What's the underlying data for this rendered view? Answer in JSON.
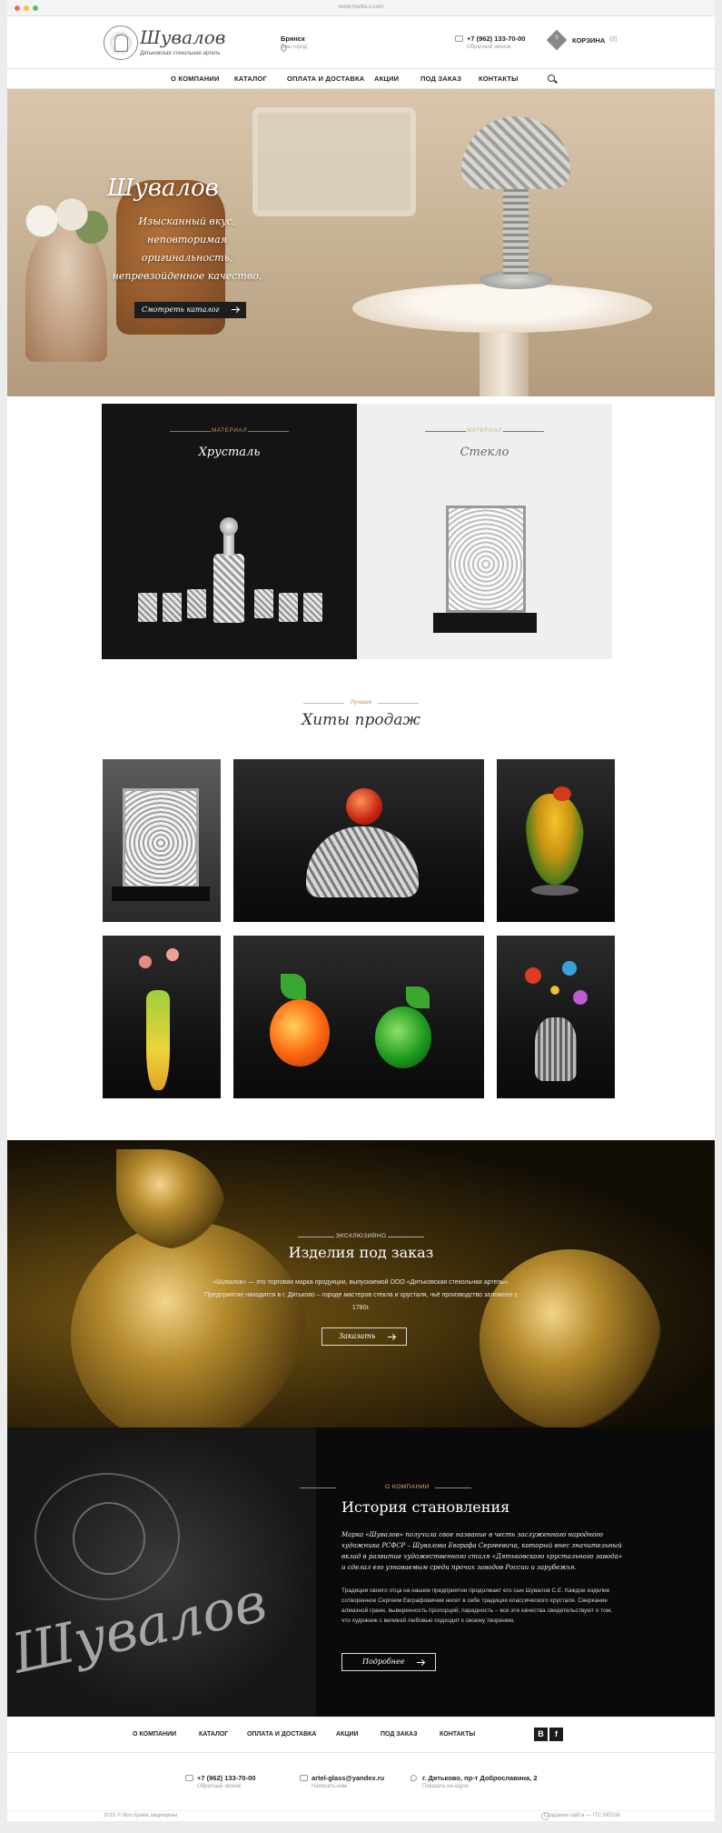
{
  "browser": {
    "url": "www.marka-x.com"
  },
  "header": {
    "logo_script": "Шувалов",
    "logo_subtitle": "Дятьковская стекольная артель",
    "city": "Брянск",
    "city_caption": "Ваш город",
    "phone": "+7 (962) 133-70-00",
    "phone_caption": "Обратный звонок",
    "cart_label": "КОРЗИНА",
    "cart_count": "(0)",
    "cart_badge": "0"
  },
  "nav": [
    "О КОМПАНИИ",
    "КАТАЛОГ",
    "ОПЛАТА И ДОСТАВКА",
    "АКЦИИ",
    "ПОД ЗАКАЗ",
    "КОНТАКТЫ"
  ],
  "hero": {
    "title": "Шувалов",
    "tagline": "Изысканный вкус, неповторимая оригинальность, непревзойденное качество.",
    "button": "Смотреть каталог"
  },
  "materials": [
    {
      "kicker": "МАТЕРИАЛ",
      "name": "Хрусталь"
    },
    {
      "kicker": "МАТЕРИАЛ",
      "name": "Стекло"
    }
  ],
  "bestsellers": {
    "kicker": "Лучшее",
    "title": "Хиты продаж"
  },
  "custom": {
    "kicker": "ЭКСКЛЮЗИВНО",
    "title": "Изделия под заказ",
    "text": "«Шувалов» — это торговая марка продукции, выпускаемой ООО «Дятьковская стекольная артель». Предприятие находится в г. Дятьково – городе мастеров стекла и хрусталя, чьё производство заложено с 1780г.",
    "button": "Заказать"
  },
  "history": {
    "kicker": "О КОМПАНИИ",
    "title": "История становления",
    "p1": "Марка «Шувалов» получила свое название в честь заслуженного народного художника РСФСР – Шувалова Евграфа Сергеевича, который внес значительный вклад в развитие художественного стиля «Дятьковского хрустального завода» и сделал его узнаваемым среди прочих заводов России и зарубежья.",
    "p2": "Традиции своего отца на нашем предприятии продолжает его сын Шувалов С.Е. Каждое изделие сотворенное Сергеем Евграфовичем несет в себе традиции классического хрусталя. Сверкание алмазной грани, выверенность пропорций, парадность – все эти качества свидетельствуют о том, что художник с великой любовью подходит к своему творению.",
    "button": "Подробнее"
  },
  "footer_nav": [
    "О КОМПАНИИ",
    "КАТАЛОГ",
    "ОПЛАТА И ДОСТАВКА",
    "АКЦИИ",
    "ПОД ЗАКАЗ",
    "КОНТАКТЫ"
  ],
  "social": [
    "В",
    "f"
  ],
  "footer_contacts": [
    {
      "main": "+7 (962) 133-70-00",
      "caption": "Обратный звонок"
    },
    {
      "main": "artel-glass@yandex.ru",
      "caption": "Написать нам"
    },
    {
      "main": "г. Дятьково, пр-т Доброславина, 2",
      "caption": "Показать на карте"
    }
  ],
  "copyright": "2015 © Все права защищены",
  "credit": "Создание сайта — ITC MEDIA"
}
